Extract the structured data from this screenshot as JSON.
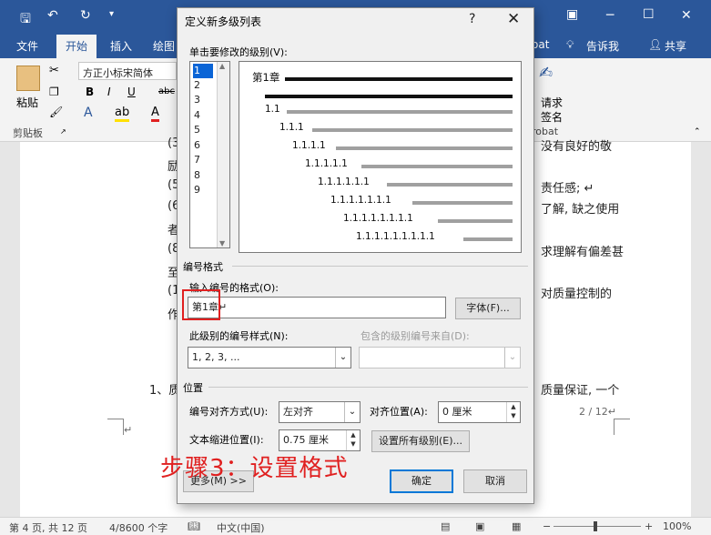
{
  "titlebar": {
    "minimize": "─",
    "maximize": "☐",
    "close": "✕"
  },
  "tabs": {
    "file": "文件",
    "home": "开始",
    "insert": "插入",
    "draw": "绘图",
    "acrobat": "oat",
    "tell_me": "告诉我",
    "share": "共享"
  },
  "ribbon": {
    "font_name": "方正小标宋简体",
    "paste_label": "粘贴",
    "clipboard_label": "剪贴板",
    "bold": "B",
    "italic": "I",
    "underline": "U",
    "strike": "abc",
    "sign_label_1": "请求",
    "sign_label_2": "签名",
    "acrobat_group": "robat"
  },
  "document": {
    "lines": [
      {
        "left": "(3",
        "right": "没有良好的敬"
      },
      {
        "left": "励",
        "right": ""
      },
      {
        "left": "(5",
        "right": "责任感; ↵"
      },
      {
        "left": "(6",
        "right": "了解, 缺之使用"
      },
      {
        "left": "者",
        "right": ""
      },
      {
        "left": "(8",
        "right": "求理解有偏差甚"
      },
      {
        "left": "至",
        "right": ""
      },
      {
        "left": "(1",
        "right": "对质量控制的"
      },
      {
        "left": "作",
        "right": ""
      }
    ],
    "item1_left": "1、质",
    "item1_right": "质量保证, 一个",
    "page_mark": "2 / 12↵",
    "enter_mark": "↵"
  },
  "dialog": {
    "title": "定义新多级列表",
    "help": "?",
    "close": "✕",
    "click_level_label": "单击要修改的级别(V):",
    "levels": [
      "1",
      "2",
      "3",
      "4",
      "5",
      "6",
      "7",
      "8",
      "9"
    ],
    "selected_level": "1",
    "preview": {
      "level1": "第1章",
      "labels": [
        "1.1",
        "1.1.1",
        "1.1.1.1",
        "1.1.1.1.1",
        "1.1.1.1.1.1",
        "1.1.1.1.1.1.1",
        "1.1.1.1.1.1.1.1",
        "1.1.1.1.1.1.1.1.1"
      ]
    },
    "number_format_section": "编号格式",
    "enter_format_label": "输入编号的格式(O):",
    "format_value": "第1章↵",
    "font_button": "字体(F)...",
    "number_style_label": "此级别的编号样式(N):",
    "number_style_value": "1, 2, 3, ...",
    "include_level_label": "包含的级别编号来自(D):",
    "position_section": "位置",
    "align_label": "编号对齐方式(U):",
    "align_value": "左对齐",
    "align_at_label": "对齐位置(A):",
    "align_at_value": "0 厘米",
    "indent_label": "文本缩进位置(I):",
    "indent_value": "0.75 厘米",
    "set_all_button": "设置所有级别(E)...",
    "more_button": "更多(M) >>",
    "ok_button": "确定",
    "cancel_button": "取消"
  },
  "annotation": {
    "caption": "步骤3：设置格式"
  },
  "statusbar": {
    "page": "第 4 页, 共 12 页",
    "words": "4/8600 个字",
    "language": "中文(中国)",
    "zoom": "100%"
  },
  "colors": {
    "accent": "#2b579a",
    "highlight": "#e02020",
    "selection": "#0a64d6"
  }
}
